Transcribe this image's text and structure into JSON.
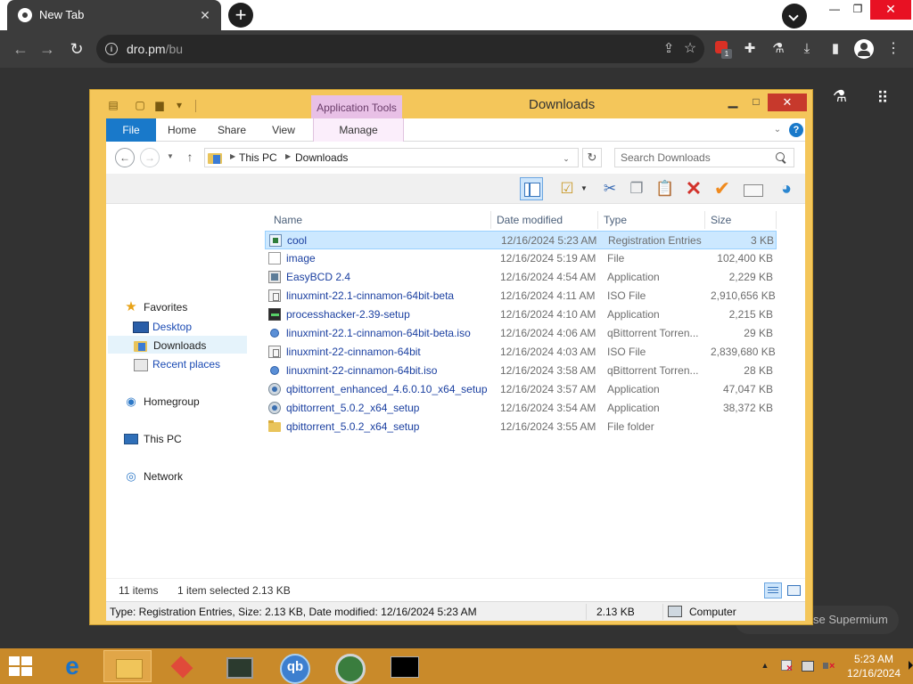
{
  "browser": {
    "tab_title": "New Tab",
    "tab_close": "✕",
    "new_tab": "+",
    "url_host": "dro.pm",
    "url_path": "/bu",
    "ext_badge_count": "1",
    "win_min": "—",
    "win_max": "❐",
    "win_close": "✕"
  },
  "page": {
    "notice": "se Supermium"
  },
  "explorer": {
    "title": "Downloads",
    "context_tab": "Application Tools",
    "ribbon_tabs": {
      "file": "File",
      "home": "Home",
      "share": "Share",
      "view": "View",
      "manage": "Manage"
    },
    "breadcrumbs": [
      "This PC",
      "Downloads"
    ],
    "search_placeholder": "Search Downloads",
    "nav": {
      "favorites": "Favorites",
      "desktop": "Desktop",
      "downloads": "Downloads",
      "recent": "Recent places",
      "homegroup": "Homegroup",
      "this_pc": "This PC",
      "network": "Network"
    },
    "columns": {
      "name": "Name",
      "date": "Date modified",
      "type": "Type",
      "size": "Size"
    },
    "files": [
      {
        "name": "cool",
        "date": "12/16/2024 5:23 AM",
        "type": "Registration Entries",
        "size": "3 KB",
        "icon": "reg-file-icon",
        "selected": true
      },
      {
        "name": "image",
        "date": "12/16/2024 5:19 AM",
        "type": "File",
        "size": "102,400 KB",
        "icon": "blank-file-icon"
      },
      {
        "name": "EasyBCD 2.4",
        "date": "12/16/2024 4:54 AM",
        "type": "Application",
        "size": "2,229 KB",
        "icon": "app-icon"
      },
      {
        "name": "linuxmint-22.1-cinnamon-64bit-beta",
        "date": "12/16/2024 4:11 AM",
        "type": "ISO File",
        "size": "2,910,656 KB",
        "icon": "iso-file-icon"
      },
      {
        "name": "processhacker-2.39-setup",
        "date": "12/16/2024 4:10 AM",
        "type": "Application",
        "size": "2,215 KB",
        "icon": "processhacker-icon"
      },
      {
        "name": "linuxmint-22.1-cinnamon-64bit-beta.iso",
        "date": "12/16/2024 4:06 AM",
        "type": "qBittorrent Torren...",
        "size": "29 KB",
        "icon": "torrent-file-icon"
      },
      {
        "name": "linuxmint-22-cinnamon-64bit",
        "date": "12/16/2024 4:03 AM",
        "type": "ISO File",
        "size": "2,839,680 KB",
        "icon": "iso-file-icon"
      },
      {
        "name": "linuxmint-22-cinnamon-64bit.iso",
        "date": "12/16/2024 3:58 AM",
        "type": "qBittorrent Torren...",
        "size": "28 KB",
        "icon": "torrent-file-icon"
      },
      {
        "name": "qbittorrent_enhanced_4.6.0.10_x64_setup",
        "date": "12/16/2024 3:57 AM",
        "type": "Application",
        "size": "47,047 KB",
        "icon": "qbittorrent-setup-icon"
      },
      {
        "name": "qbittorrent_5.0.2_x64_setup",
        "date": "12/16/2024 3:54 AM",
        "type": "Application",
        "size": "38,372 KB",
        "icon": "qbittorrent-setup-icon"
      },
      {
        "name": "qbittorrent_5.0.2_x64_setup",
        "date": "12/16/2024 3:55 AM",
        "type": "File folder",
        "size": "",
        "icon": "folder-icon"
      }
    ],
    "status": {
      "item_count": "11 items",
      "selected": "1 item selected  2.13 KB"
    },
    "info_bar": {
      "details": "Type: Registration Entries, Size: 2.13 KB, Date modified: 12/16/2024 5:23 AM",
      "size": "2.13 KB",
      "location": "Computer"
    }
  },
  "taskbar": {
    "ie_glyph": "e",
    "time": "5:23 AM",
    "date": "12/16/2024"
  }
}
